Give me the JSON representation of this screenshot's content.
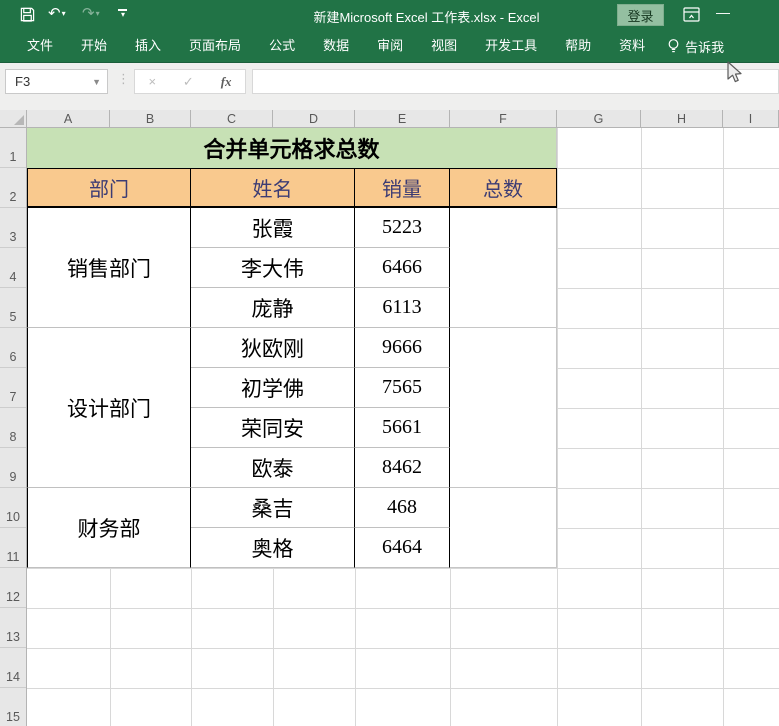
{
  "window": {
    "title": "新建Microsoft Excel 工作表.xlsx - Excel",
    "login": "登录"
  },
  "ribbon": {
    "tabs": [
      "文件",
      "开始",
      "插入",
      "页面布局",
      "公式",
      "数据",
      "审阅",
      "视图",
      "开发工具",
      "帮助",
      "资料"
    ],
    "tab_keys": [
      "file",
      "home",
      "insert",
      "page-layout",
      "formulas",
      "data",
      "review",
      "view",
      "developer",
      "help",
      "ziliao"
    ],
    "tell_me": "告诉我"
  },
  "formula_bar": {
    "name_box": "F3",
    "fx": "fx",
    "formula": ""
  },
  "sheet": {
    "column_headers": [
      "A",
      "B",
      "C",
      "D",
      "E",
      "F",
      "G",
      "H",
      "I"
    ],
    "row_headers": [
      "1",
      "2",
      "3",
      "4",
      "5",
      "6",
      "7",
      "8",
      "9",
      "10",
      "11",
      "12",
      "13",
      "14",
      "15"
    ],
    "title": "合并单元格求总数",
    "headers": {
      "department": "部门",
      "name": "姓名",
      "sales": "销量",
      "total": "总数"
    },
    "groups": [
      {
        "department": "销售部门",
        "members": [
          {
            "name": "张霞",
            "sales": "5223"
          },
          {
            "name": "李大伟",
            "sales": "6466"
          },
          {
            "name": "庞静",
            "sales": "6113"
          }
        ]
      },
      {
        "department": "设计部门",
        "members": [
          {
            "name": "狄欧刚",
            "sales": "9666"
          },
          {
            "name": "初学佛",
            "sales": "7565"
          },
          {
            "name": "荣同安",
            "sales": "5661"
          },
          {
            "name": "欧泰",
            "sales": "8462"
          }
        ]
      },
      {
        "department": "财务部",
        "members": [
          {
            "name": "桑吉",
            "sales": "468"
          },
          {
            "name": "奥格",
            "sales": "6464"
          }
        ]
      }
    ]
  },
  "colors": {
    "chrome_green": "#217346",
    "title_fill": "#C7E1B5",
    "header_fill": "#F9C98E",
    "header_text": "#3C3C74",
    "gridline": "#d8d8d8"
  }
}
